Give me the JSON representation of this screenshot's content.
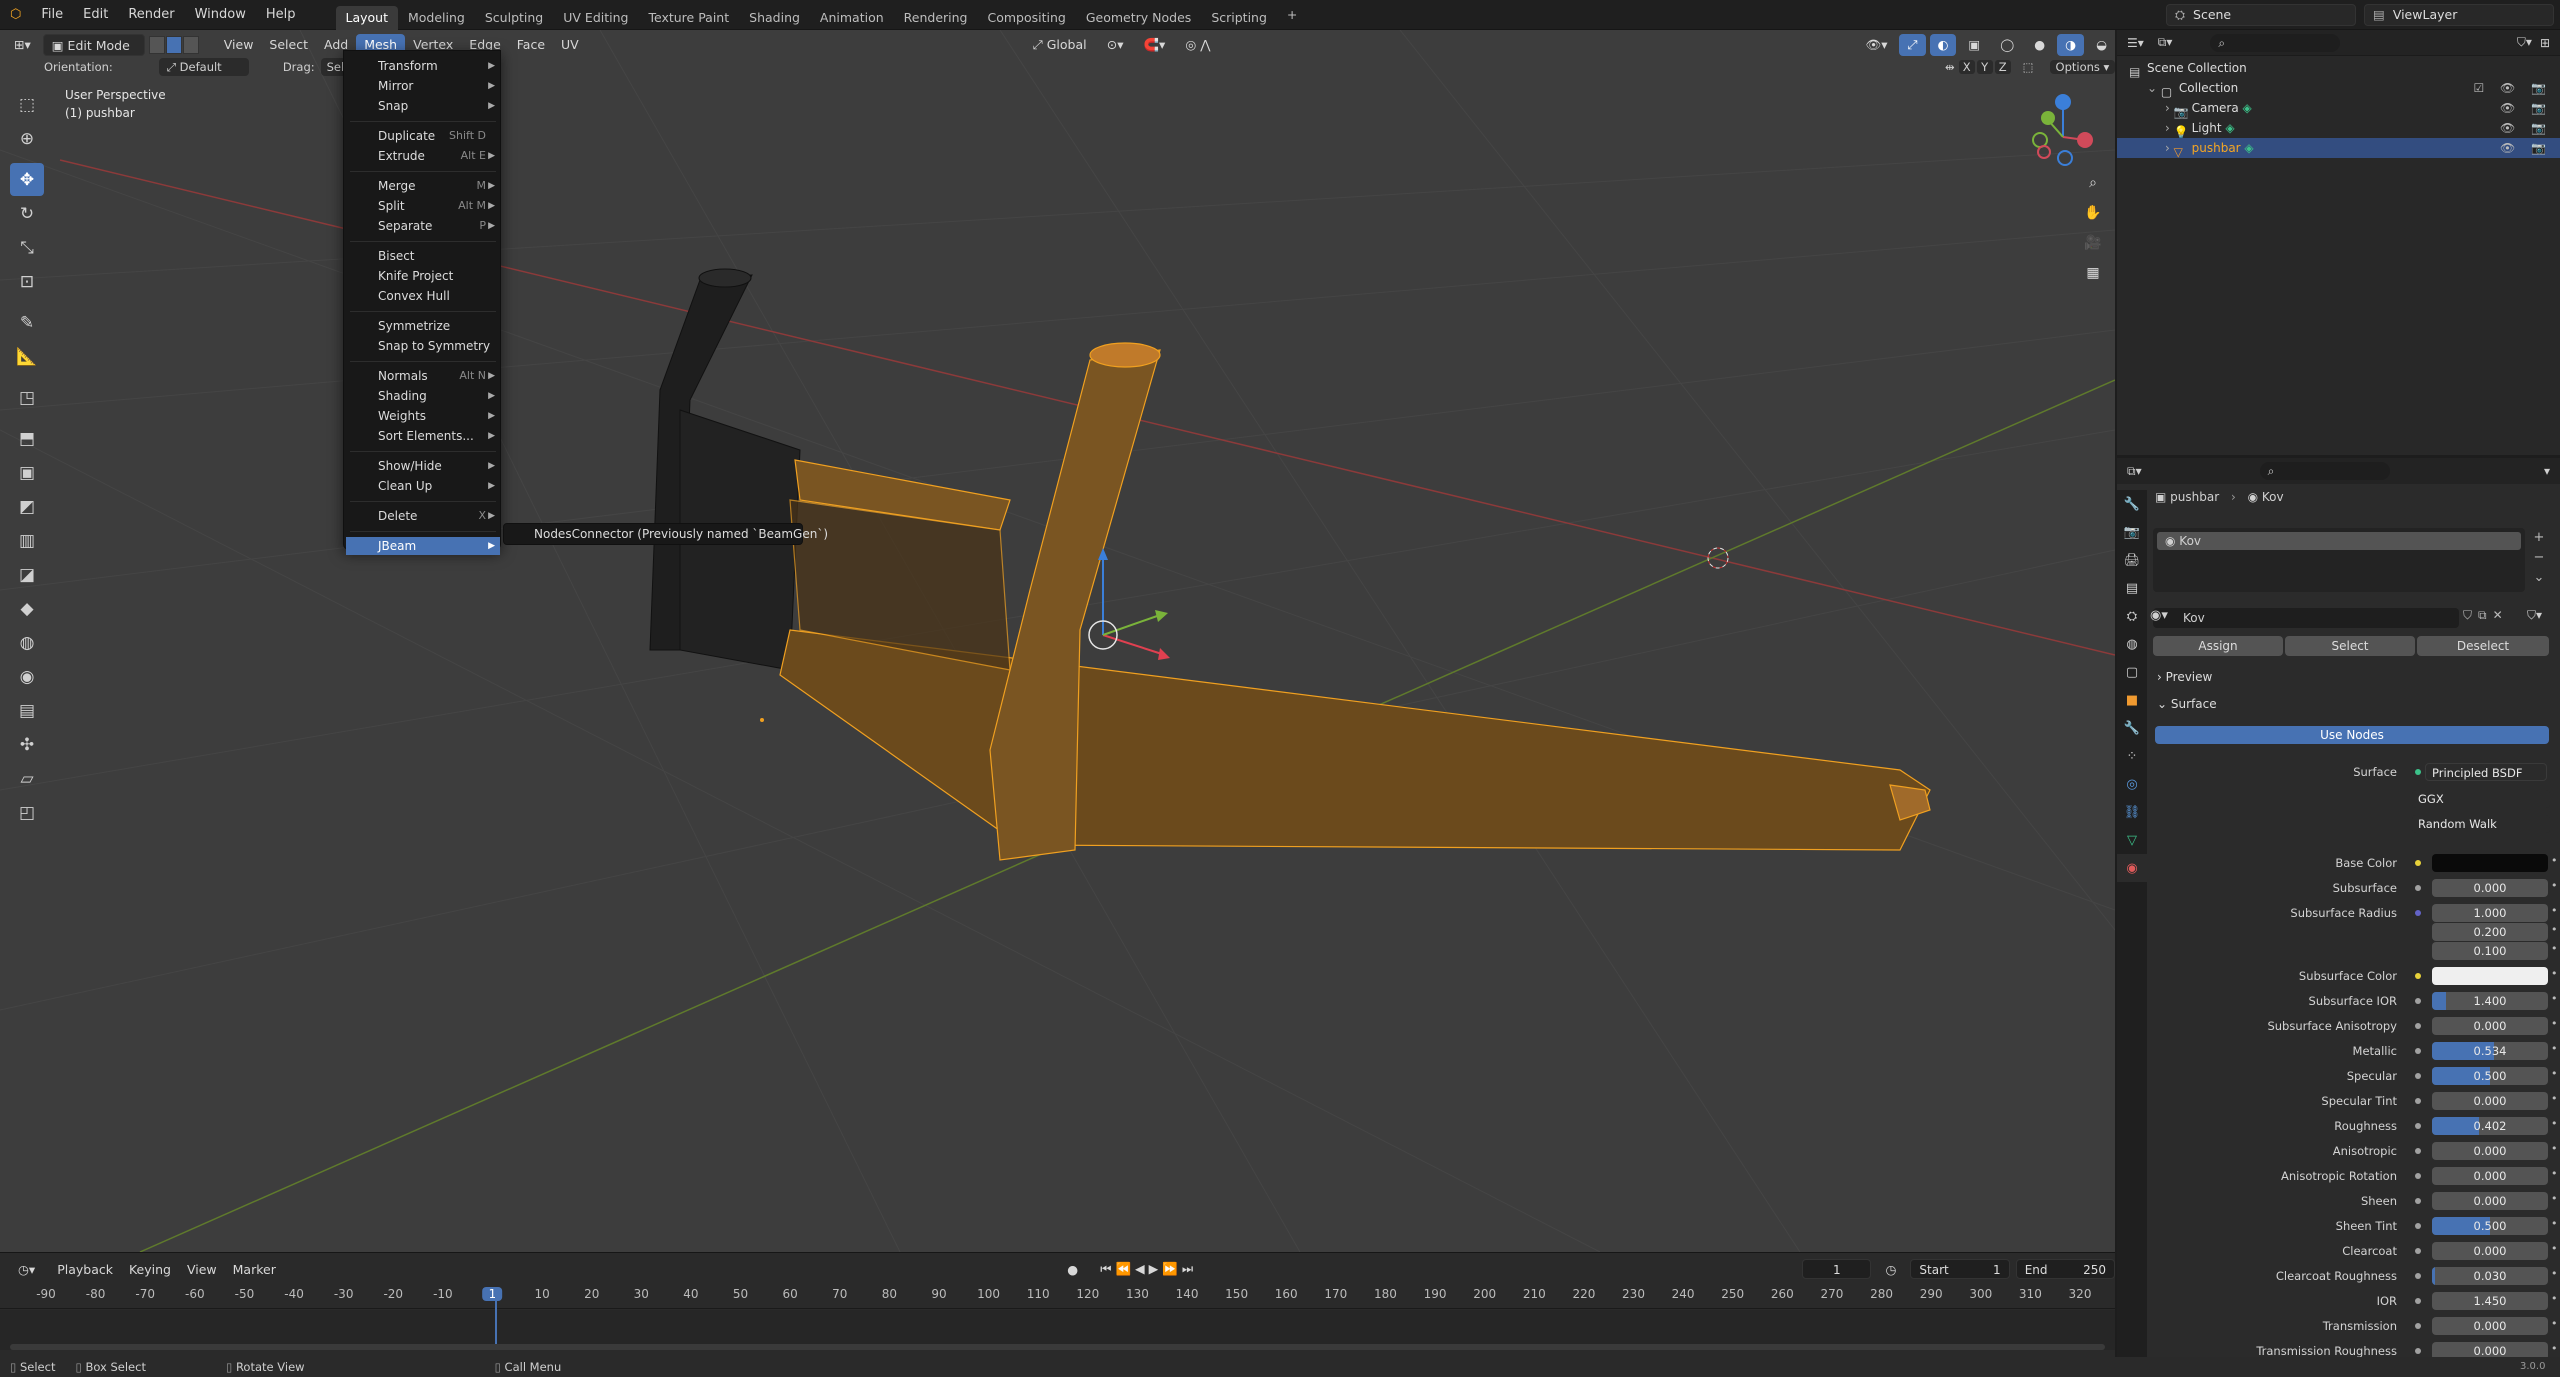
{
  "topbar": {
    "menus": [
      "File",
      "Edit",
      "Render",
      "Window",
      "Help"
    ],
    "workspaces": [
      "Layout",
      "Modeling",
      "Sculpting",
      "UV Editing",
      "Texture Paint",
      "Shading",
      "Animation",
      "Rendering",
      "Compositing",
      "Geometry Nodes",
      "Scripting"
    ],
    "active_workspace": "Layout",
    "add_tab": "+",
    "scene": "Scene",
    "view_layer": "ViewLayer"
  },
  "viewport_header": {
    "mode": "Edit Mode",
    "menus": [
      "View",
      "Select",
      "Add",
      "Mesh",
      "Vertex",
      "Edge",
      "Face",
      "UV"
    ],
    "active_menu": "Mesh",
    "transform_orientation": "Global",
    "orientation_label": "Orientation:",
    "orientation_value": "Default",
    "drag_label": "Drag:",
    "drag_value": "Select Bo",
    "options": "Options",
    "axes": [
      "X",
      "Y",
      "Z"
    ]
  },
  "viewport": {
    "view_name": "User Perspective",
    "object_name": "(1) pushbar"
  },
  "mesh_menu": {
    "items": [
      {
        "label": "Transform",
        "shortcut": "",
        "sub": true
      },
      {
        "label": "Mirror",
        "shortcut": "",
        "sub": true
      },
      {
        "label": "Snap",
        "shortcut": "",
        "sub": true
      },
      {
        "label": "Duplicate",
        "shortcut": "Shift D",
        "sub": false
      },
      {
        "label": "Extrude",
        "shortcut": "Alt E",
        "sub": true
      },
      {
        "label": "Merge",
        "shortcut": "M",
        "sub": true
      },
      {
        "label": "Split",
        "shortcut": "Alt M",
        "sub": true
      },
      {
        "label": "Separate",
        "shortcut": "P",
        "sub": true
      },
      {
        "label": "Bisect",
        "shortcut": "",
        "sub": false
      },
      {
        "label": "Knife Project",
        "shortcut": "",
        "sub": false
      },
      {
        "label": "Convex Hull",
        "shortcut": "",
        "sub": false
      },
      {
        "label": "Symmetrize",
        "shortcut": "",
        "sub": false
      },
      {
        "label": "Snap to Symmetry",
        "shortcut": "",
        "sub": false
      },
      {
        "label": "Normals",
        "shortcut": "Alt N",
        "sub": true
      },
      {
        "label": "Shading",
        "shortcut": "",
        "sub": true
      },
      {
        "label": "Weights",
        "shortcut": "",
        "sub": true
      },
      {
        "label": "Sort Elements...",
        "shortcut": "",
        "sub": true
      },
      {
        "label": "Show/Hide",
        "shortcut": "",
        "sub": true
      },
      {
        "label": "Clean Up",
        "shortcut": "",
        "sub": true
      },
      {
        "label": "Delete",
        "shortcut": "X",
        "sub": true
      },
      {
        "label": "JBeam",
        "shortcut": "",
        "sub": true
      }
    ],
    "submenu_item": "NodesConnector (Previously named `BeamGen`)"
  },
  "timeline": {
    "menus": [
      "Playback",
      "Keying",
      "View",
      "Marker"
    ],
    "current_frame": "1",
    "start_label": "Start",
    "start": "1",
    "end_label": "End",
    "end": "250",
    "ruler": [
      "-90",
      "-80",
      "-70",
      "-60",
      "-50",
      "-40",
      "-30",
      "-20",
      "-10",
      "1",
      "10",
      "20",
      "30",
      "40",
      "50",
      "60",
      "70",
      "80",
      "90",
      "100",
      "110",
      "120",
      "130",
      "140",
      "150",
      "160",
      "170",
      "180",
      "190",
      "200",
      "210",
      "220",
      "230",
      "240",
      "250",
      "260",
      "270",
      "280",
      "290",
      "300",
      "310",
      "320"
    ]
  },
  "statusbar": {
    "items": [
      "Select",
      "Box Select",
      "Rotate View",
      "Call Menu"
    ],
    "version": "3.0.0"
  },
  "outliner": {
    "rows": [
      {
        "label": "Scene Collection",
        "indent": 0
      },
      {
        "label": "Collection",
        "indent": 1
      },
      {
        "label": "Camera",
        "indent": 2
      },
      {
        "label": "Light",
        "indent": 2
      },
      {
        "label": "pushbar",
        "indent": 2
      }
    ]
  },
  "properties": {
    "breadcrumb_object": "pushbar",
    "breadcrumb_material": "Kov",
    "slot": "Kov",
    "material_name": "Kov",
    "assign": "Assign",
    "select": "Select",
    "deselect": "Deselect",
    "preview": "Preview",
    "surface_section": "Surface",
    "use_nodes": "Use Nodes",
    "surface_label": "Surface",
    "surface_value": "Principled BSDF",
    "distribution": "GGX",
    "subsurface_method": "Random Walk",
    "fields": [
      {
        "label": "Base Color",
        "value": "",
        "type": "color",
        "color": "#0a0a0a"
      },
      {
        "label": "Subsurface",
        "value": "0.000",
        "fill": 0
      },
      {
        "label": "Subsurface Radius",
        "value": "1.000",
        "fill": 0
      },
      {
        "label": "",
        "value": "0.200",
        "fill": 0
      },
      {
        "label": "",
        "value": "0.100",
        "fill": 0
      },
      {
        "label": "Subsurface Color",
        "value": "",
        "type": "color",
        "color": "#efefef"
      },
      {
        "label": "Subsurface IOR",
        "value": "1.400",
        "fill": 0.12
      },
      {
        "label": "Subsurface Anisotropy",
        "value": "0.000",
        "fill": 0
      },
      {
        "label": "Metallic",
        "value": "0.534",
        "fill": 0.534
      },
      {
        "label": "Specular",
        "value": "0.500",
        "fill": 0.5
      },
      {
        "label": "Specular Tint",
        "value": "0.000",
        "fill": 0
      },
      {
        "label": "Roughness",
        "value": "0.402",
        "fill": 0.402
      },
      {
        "label": "Anisotropic",
        "value": "0.000",
        "fill": 0
      },
      {
        "label": "Anisotropic Rotation",
        "value": "0.000",
        "fill": 0
      },
      {
        "label": "Sheen",
        "value": "0.000",
        "fill": 0
      },
      {
        "label": "Sheen Tint",
        "value": "0.500",
        "fill": 0.5
      },
      {
        "label": "Clearcoat",
        "value": "0.000",
        "fill": 0
      },
      {
        "label": "Clearcoat Roughness",
        "value": "0.030",
        "fill": 0.03
      },
      {
        "label": "IOR",
        "value": "1.450",
        "fill": 0
      },
      {
        "label": "Transmission",
        "value": "0.000",
        "fill": 0
      },
      {
        "label": "Transmission Roughness",
        "value": "0.000",
        "fill": 0
      }
    ]
  },
  "colors": {
    "accent": "#4772b3",
    "selection_orange": "#f0a020",
    "viewport_bg": "#3d3d3d"
  }
}
